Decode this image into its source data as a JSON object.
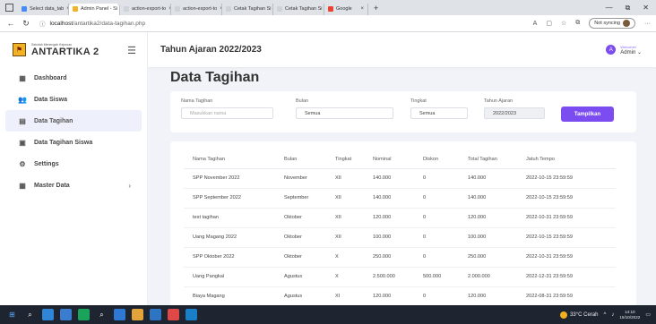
{
  "browser": {
    "tabs": [
      {
        "label": "Select data_tab",
        "fav": "#4a8af4",
        "active": false
      },
      {
        "label": "Admin Panel - Si",
        "fav": "#f2b224",
        "active": true
      },
      {
        "label": "action-export-to",
        "fav": "#cfd3d8",
        "active": false
      },
      {
        "label": "action-export-to",
        "fav": "#cfd3d8",
        "active": false
      },
      {
        "label": "Cetak Tagihan Si",
        "fav": "#cfd3d8",
        "active": false
      },
      {
        "label": "Cetak Tagihan Si",
        "fav": "#cfd3d8",
        "active": false
      },
      {
        "label": "Google",
        "fav": "#ea4335",
        "active": false
      }
    ],
    "new_tab": "+",
    "window_controls": [
      "—",
      "⧉",
      "✕"
    ],
    "url_host": "localhost",
    "url_path": "/antartika2/data-tagihan.php",
    "sync_label": "Not syncing"
  },
  "sidebar": {
    "brand_sub": "Sekolah Menengah Kejuruan",
    "brand_name": "ANTARTIKA 2",
    "menu": [
      {
        "label": "Dashboard",
        "icon": "▦",
        "name": "dashboard",
        "active": false
      },
      {
        "label": "Data Siswa",
        "icon": "👥",
        "name": "data-siswa",
        "active": false
      },
      {
        "label": "Data Tagihan",
        "icon": "▤",
        "name": "data-tagihan",
        "active": true
      },
      {
        "label": "Data Tagihan Siswa",
        "icon": "▣",
        "name": "data-tagihan-siswa",
        "active": false
      },
      {
        "label": "Settings",
        "icon": "⚙",
        "name": "settings",
        "active": false
      },
      {
        "label": "Master Data",
        "icon": "▦",
        "name": "master-data",
        "active": false,
        "chevron": "›"
      }
    ]
  },
  "header": {
    "academic_year": "Tahun Ajaran 2022/2023",
    "welcome": "Welcome!",
    "user": "Admin ⌄",
    "avatar_letter": "A"
  },
  "page": {
    "title": "Data Tagihan"
  },
  "filters": {
    "nama_label": "Nama Tagihan",
    "nama_placeholder": "Masukkan nama",
    "bulan_label": "Bulan",
    "bulan_value": "Semua",
    "tingkat_label": "Tingkat",
    "tingkat_value": "Semua",
    "tahun_label": "Tahun Ajaran",
    "tahun_value": "2022/2023",
    "button": "Tampilkan"
  },
  "table": {
    "columns": [
      "Nama Tagihan",
      "Bulan",
      "Tingkat",
      "Nominal",
      "Diskon",
      "Total Tagihan",
      "Jatuh Tempo"
    ],
    "rows": [
      [
        "SPP November 2022",
        "November",
        "XII",
        "140.000",
        "0",
        "140.000",
        "2022-10-15 23:59:59"
      ],
      [
        "SPP September 2022",
        "September",
        "XII",
        "140.000",
        "0",
        "140.000",
        "2022-10-15 23:59:59"
      ],
      [
        "test tagihan",
        "Oktober",
        "XII",
        "120.000",
        "0",
        "120.000",
        "2022-10-31 23:59:59"
      ],
      [
        "Uang Magang 2022",
        "Oktober",
        "XII",
        "100.000",
        "0",
        "100.000",
        "2022-10-15 23:59:59"
      ],
      [
        "SPP Oktober 2022",
        "Oktober",
        "X",
        "250.000",
        "0",
        "250.000",
        "2022-10-31 23:59:59"
      ],
      [
        "Uang Pangkal",
        "Agustus",
        "X",
        "2.500.000",
        "500.000",
        "2.000.000",
        "2022-12-31 23:59:59"
      ],
      [
        "Biaya Magang",
        "Agustus",
        "XI",
        "120.000",
        "0",
        "120.000",
        "2022-08-31 23:59:59"
      ]
    ]
  },
  "taskbar": {
    "weather": "33°C Cerah",
    "time": "14:10",
    "date": "15/10/2022"
  },
  "colors": {
    "accent": "#7b4cf0",
    "logo": "#f2b224",
    "taskbar": "#1f2431"
  }
}
